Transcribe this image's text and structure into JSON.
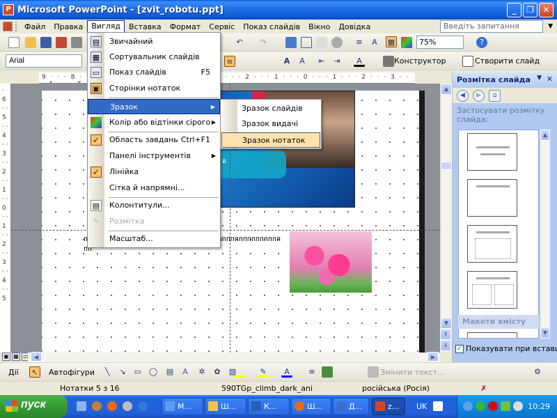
{
  "window": {
    "title": "Microsoft PowerPoint - [zvit_robotu.ppt]",
    "app_icon": "powerpoint-icon"
  },
  "menubar": {
    "items": [
      "Файл",
      "Правка",
      "Вигляд",
      "Вставка",
      "Формат",
      "Сервіс",
      "Показ слайдів",
      "Вікно",
      "Довідка"
    ],
    "open_index": 2,
    "help_placeholder": "Введіть запитання"
  },
  "toolbar_standard": {
    "zoom": "75%"
  },
  "toolbar_formatting": {
    "font": "Arial",
    "designer_label": "Конструктор",
    "new_slide_label": "Створити слайд"
  },
  "view_menu": {
    "items": [
      {
        "label": "Звичайний",
        "icon": "normal-view-icon"
      },
      {
        "label": "Сортувальник слайдів",
        "icon": "slide-sorter-icon"
      },
      {
        "label": "Показ слайдів",
        "shortcut": "F5",
        "icon": "slideshow-icon"
      },
      {
        "label": "Сторінки нотаток",
        "icon": "notes-page-icon",
        "checked_box": true
      },
      {
        "label": "Зразок",
        "submenu": true,
        "highlighted": true
      },
      {
        "label": "Колір або відтінки сірого",
        "submenu": true,
        "icon": "color-icon"
      },
      {
        "label": "Область завдань",
        "shortcut": "Ctrl+F1",
        "checked": true
      },
      {
        "label": "Панелі інструментів",
        "submenu": true
      },
      {
        "label": "Лінійка",
        "checked": true
      },
      {
        "label": "Сітка й напрямні..."
      },
      {
        "label": "Колонтитули...",
        "icon": "header-footer-icon"
      },
      {
        "label": "Розмітка",
        "disabled": true,
        "icon": "markup-icon"
      },
      {
        "label": "Масштаб..."
      }
    ]
  },
  "master_submenu": {
    "items": [
      "Зразок слайдів",
      "Зразок видачі",
      "Зразок нотаток"
    ],
    "highlighted_index": 2
  },
  "canvas": {
    "notes_text_line1": "ппппппппппппппппппппппппппппппппппппппппппппппп",
    "notes_text_line2": "пп",
    "slide_caption_char": "в"
  },
  "task_pane": {
    "title": "Розмітка слайда",
    "apply_label": "Застосувати розмітку слайда:",
    "section_label": "Макети вмісту",
    "show_on_insert_label": "Показувати при вставці",
    "show_on_insert_checked": true
  },
  "drawing_toolbar": {
    "actions_label": "Дії",
    "autoshapes_label": "Автофігури",
    "change_text_label": "Змінити текст..."
  },
  "statusbar": {
    "notes": "Нотатки 5 з 16",
    "design": "590TGp_climb_dark_ani",
    "language": "російська (Росія)"
  },
  "taskbar": {
    "start_label": "пуск",
    "tasks": [
      "М...",
      "Ш...",
      "К...",
      "Ш...",
      "Д...",
      "z..."
    ],
    "language": "UK",
    "clock": "10:29"
  }
}
